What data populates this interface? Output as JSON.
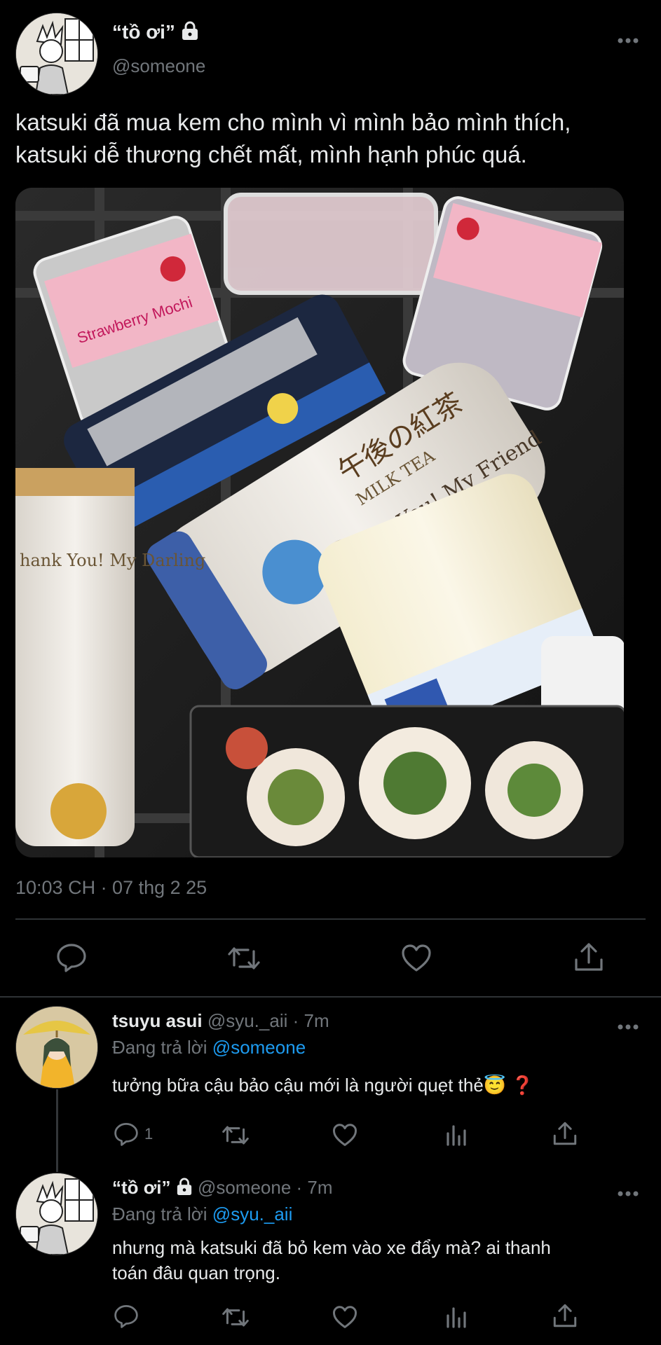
{
  "main_tweet": {
    "display_name": "“tồ ơi”",
    "handle": "@someone",
    "text_line1": "katsuki đã mua kem cho mình vì mình bảo mình thích,",
    "text_line2": "katsuki dễ thương chết mất, mình hạnh phúc quá.",
    "timestamp": "10:03 CH · 07 thg 2 25",
    "photo_label_1": "Strawberry Mochi",
    "photo_label_2": "MILK TEA",
    "photo_label_3": "Thank You! My Friend",
    "photo_label_4": "hank You! My Darling",
    "photo_label_5": "午後の紅茶"
  },
  "reply_1": {
    "display_name": "tsuyu asui",
    "handle_time": "@syu._aii · 7m",
    "replying_prefix": "Đang trả lời",
    "replying_to": "@someone",
    "text": "tưởng bữa cậu bảo cậu mới là người quẹt thẻ😇 ❓",
    "reply_count": "1"
  },
  "reply_2": {
    "display_name": "“tồ ơi”",
    "handle_time": "@someone · 7m",
    "replying_prefix": "Đang trả lời",
    "replying_to": "@syu._aii",
    "text_line1": "nhưng mà katsuki đã bỏ kem vào xe đẩy mà? ai thanh",
    "text_line2": "toán đâu quan trọng."
  },
  "icons": {
    "more": "more-dots-icon",
    "reply": "reply-bubble-icon",
    "retweet": "retweet-icon",
    "like": "heart-icon",
    "share": "share-icon",
    "analytics": "analytics-bars-icon",
    "lock": "lock-icon"
  },
  "colors": {
    "background": "#000000",
    "text": "#e7e9ea",
    "muted": "#71767b",
    "link": "#1d9bf0",
    "divider": "#2f3336"
  }
}
